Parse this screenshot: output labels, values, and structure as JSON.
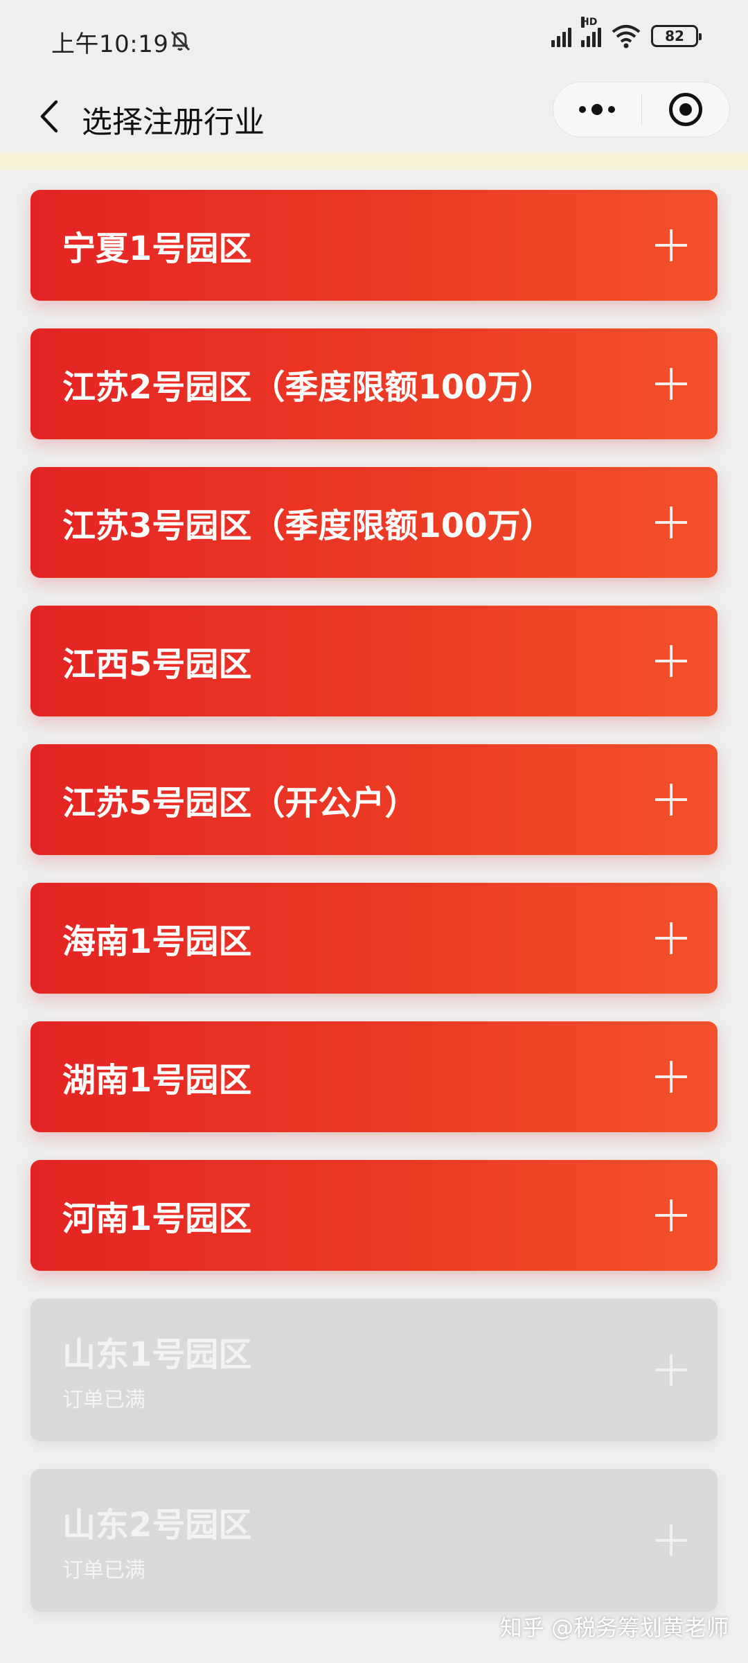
{
  "status_bar": {
    "time": "上午10:19",
    "hd_label": "HD",
    "battery_level": "82"
  },
  "nav": {
    "title": "选择注册行业"
  },
  "colors": {
    "card_gradient_start": "#e42423",
    "card_gradient_end": "#f4502a",
    "card_disabled": "#d9d9d9",
    "background": "#efefef"
  },
  "icons": {
    "back": "chevron-left-icon",
    "more": "more-dots-icon",
    "close": "target-circle-icon",
    "mute": "bell-off-icon",
    "expand": "plus-icon"
  },
  "parks": [
    {
      "name": "宁夏1号园区",
      "status": ""
    },
    {
      "name": "江苏2号园区（季度限额100万）",
      "status": ""
    },
    {
      "name": "江苏3号园区（季度限额100万）",
      "status": ""
    },
    {
      "name": "江西5号园区",
      "status": ""
    },
    {
      "name": "江苏5号园区（开公户）",
      "status": ""
    },
    {
      "name": "海南1号园区",
      "status": ""
    },
    {
      "name": "湖南1号园区",
      "status": ""
    },
    {
      "name": "河南1号园区",
      "status": ""
    },
    {
      "name": "山东1号园区",
      "status": "订单已满"
    },
    {
      "name": "山东2号园区",
      "status": "订单已满"
    }
  ],
  "watermark": "知乎 @税务筹划黄老师"
}
